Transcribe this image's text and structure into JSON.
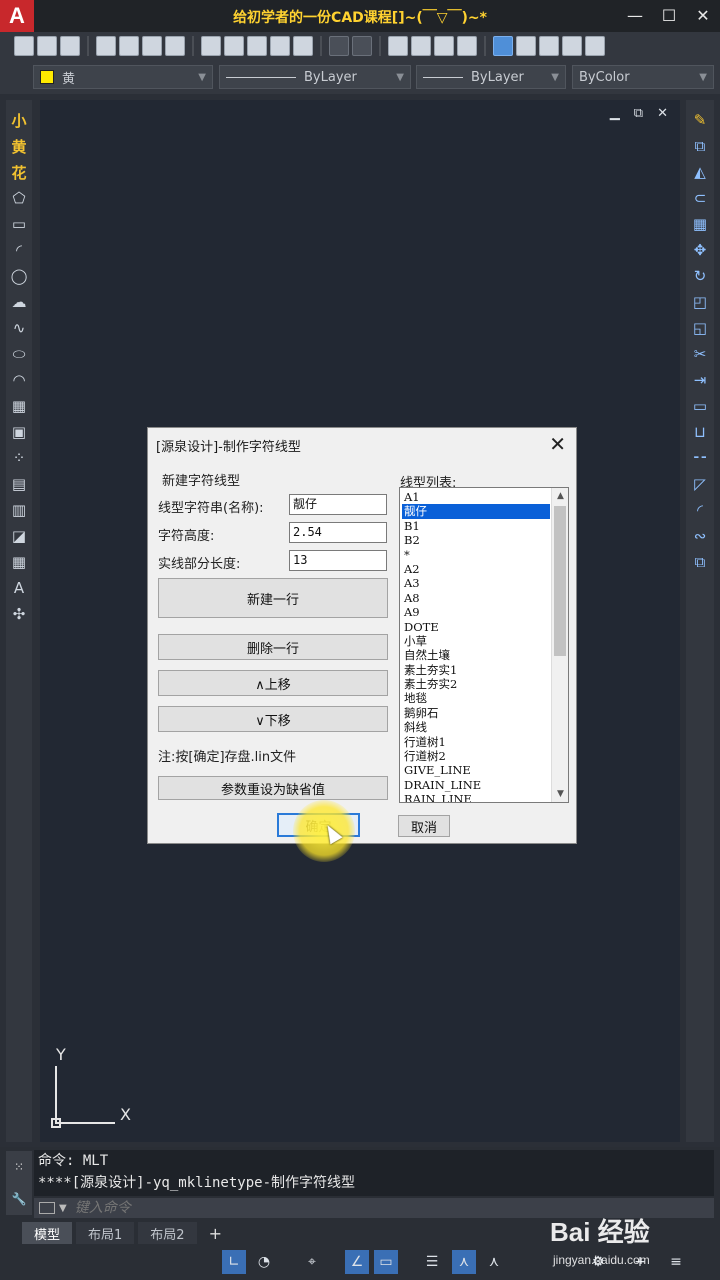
{
  "app": {
    "logo": "A",
    "title": "给初学者的一份CAD课程[]~(￣▽￣)~*",
    "window_controls": [
      "—",
      "☐",
      "✕"
    ]
  },
  "properties": {
    "color": "黄",
    "linetype": "ByLayer",
    "lineweight": "ByLayer",
    "plotstyle": "ByColor"
  },
  "left_toolbar": {
    "text_items": [
      "小",
      "黄",
      "花"
    ]
  },
  "canvas": {
    "controls": [
      "▁",
      "⧉",
      "✕"
    ],
    "ucs": {
      "y": "Y",
      "x": "X"
    }
  },
  "dialog": {
    "title": "[源泉设计]-制作字符线型",
    "close": "✕",
    "group_label": "新建字符线型",
    "name_label": "线型字符串(名称):",
    "name_value": "靓仔",
    "height_label": "字符高度:",
    "height_value": "2.54",
    "solid_label": "实线部分长度:",
    "solid_value": "13",
    "new_row": "新建一行",
    "delete_row": "删除一行",
    "move_up": "∧上移",
    "move_down": "∨下移",
    "note": "注:按[确定]存盘.lin文件",
    "reset": "参数重设为缺省值",
    "list_label": "线型列表:",
    "linetypes": [
      "A1",
      "靓仔",
      "B1",
      "B2",
      "*",
      "A2",
      "A3",
      "A8",
      "A9",
      "DOTE",
      "小草",
      "自然土壤",
      "素土夯实1",
      "素土夯实2",
      "地毯",
      "鹅卵石",
      "斜线",
      "行道树1",
      "行道树2",
      "GIVE_LINE",
      "DRAIN_LINE",
      "RAIN_LINE"
    ],
    "selected_index": 1,
    "ok": "确定",
    "cancel": "取消"
  },
  "command": {
    "line1": "命令: MLT",
    "line2": "****[源泉设计]-yq_mklinetype-制作字符线型",
    "placeholder": "键入命令"
  },
  "tabs": {
    "model": "模型",
    "layout1": "布局1",
    "layout2": "布局2",
    "add": "+"
  },
  "watermark": {
    "brand": "Bai 经验",
    "url": "jingyan.baidu.com"
  }
}
